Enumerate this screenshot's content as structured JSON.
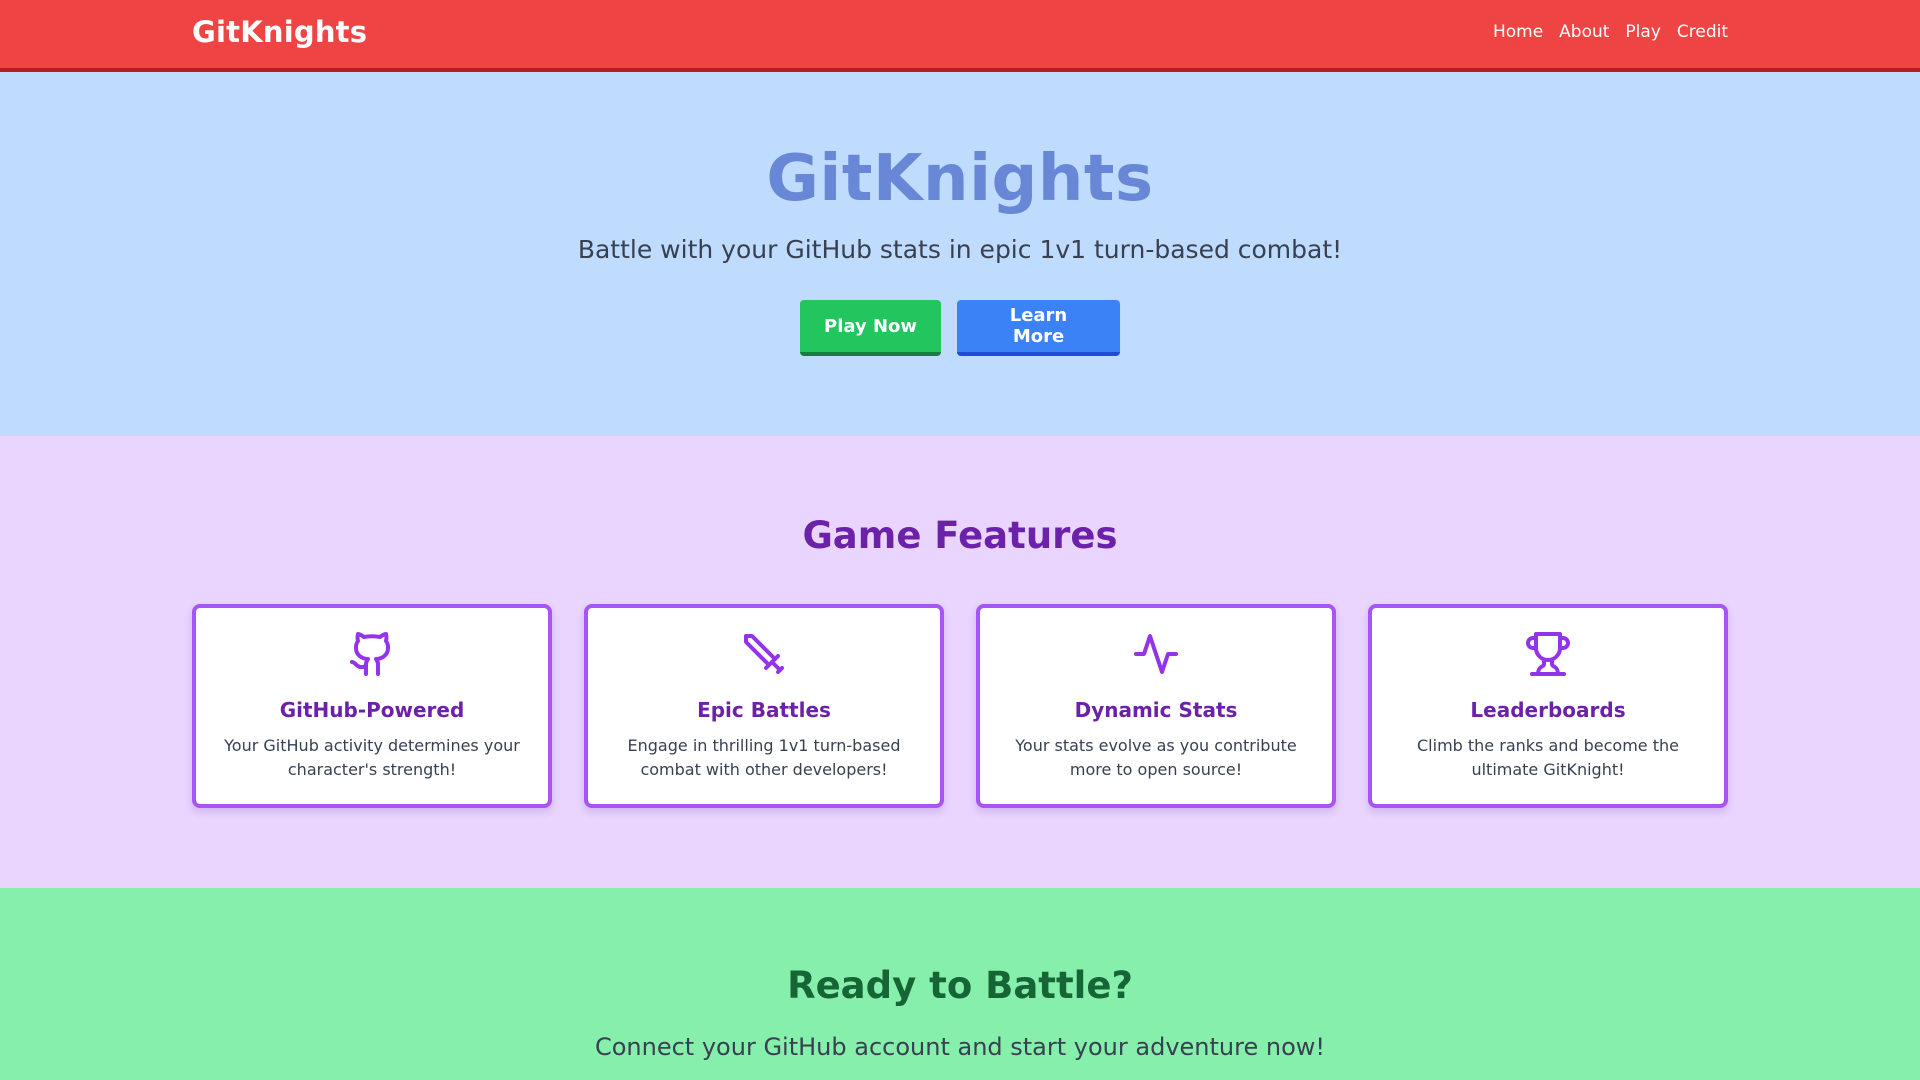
{
  "nav": {
    "brand": "GitKnights",
    "links": [
      "Home",
      "About",
      "Play",
      "Credit"
    ]
  },
  "hero": {
    "title": "GitKnights",
    "subtitle": "Battle with your GitHub stats in epic 1v1 turn-based combat!",
    "play_label": "Play Now",
    "learn_label": "Learn More"
  },
  "features": {
    "title": "Game Features",
    "cards": [
      {
        "icon": "github-icon",
        "title": "GitHub-Powered",
        "desc": "Your GitHub activity determines your character's strength!"
      },
      {
        "icon": "sword-icon",
        "title": "Epic Battles",
        "desc": "Engage in thrilling 1v1 turn-based combat with other developers!"
      },
      {
        "icon": "activity-icon",
        "title": "Dynamic Stats",
        "desc": "Your stats evolve as you contribute more to open source!"
      },
      {
        "icon": "trophy-icon",
        "title": "Leaderboards",
        "desc": "Climb the ranks and become the ultimate GitKnight!"
      }
    ]
  },
  "cta": {
    "title": "Ready to Battle?",
    "subtitle": "Connect your GitHub account and start your adventure now!"
  },
  "colors": {
    "nav_bg": "#ef4444",
    "hero_bg": "#bfdbfe",
    "features_bg": "#e9d5ff",
    "cta_bg": "#86efac",
    "accent_purple": "#a855f7",
    "play_green": "#22c55e",
    "learn_blue": "#3b82f6"
  }
}
